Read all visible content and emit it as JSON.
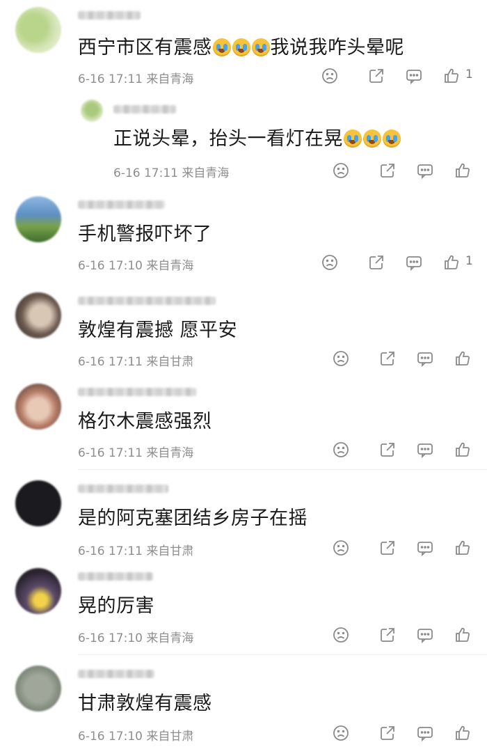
{
  "comments": [
    {
      "text": "西宁市区有震感",
      "suffix_text": "我说我咋头晕呢",
      "emoji_before_suffix": 3,
      "meta": "6-16 17:11 来自青海",
      "likes": "1"
    },
    {
      "text": "正说头晕，抬头一看灯在晃",
      "emoji_after": 3,
      "meta": "6-16 17:11 来自青海",
      "likes": ""
    },
    {
      "text": "手机警报吓坏了",
      "meta": "6-16 17:10 来自青海",
      "likes": "1"
    },
    {
      "text": "敦煌有震撼 愿平安",
      "meta": "6-16 17:11 来自甘肃",
      "likes": ""
    },
    {
      "text": "格尔木震感强烈",
      "meta": "6-16 17:11 来自青海",
      "likes": ""
    },
    {
      "text": "是的阿克塞团结乡房子在摇",
      "meta": "6-16 17:11 来自甘肃",
      "likes": ""
    },
    {
      "text": "晃的厉害",
      "meta": "6-16 17:10 来自青海",
      "likes": ""
    },
    {
      "text": "甘肃敦煌有震感",
      "meta": "6-16 17:10 来自甘肃",
      "likes": ""
    }
  ],
  "icons": {
    "dislike": "frown-face-icon",
    "repost": "share-square-icon",
    "comment": "comment-bubble-icon",
    "like": "thumbs-up-icon"
  },
  "colors": {
    "text": "#1a1a1a",
    "meta": "#8e8e8e",
    "icon": "#8a8a8a",
    "emoji": "#f6c33a"
  }
}
